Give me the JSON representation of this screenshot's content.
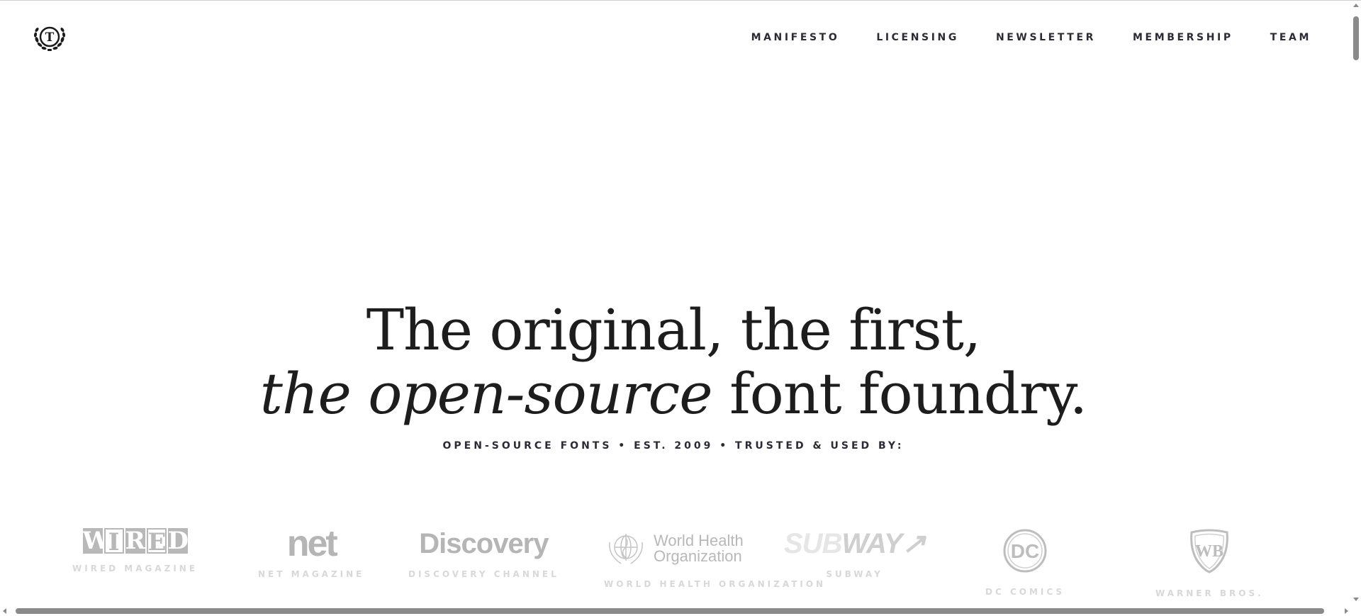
{
  "header": {
    "logo_icon": "laurel-t-monogram-icon",
    "logo_letter": "T",
    "nav": [
      {
        "label": "MANIFESTO"
      },
      {
        "label": "LICENSING"
      },
      {
        "label": "NEWSLETTER"
      },
      {
        "label": "MEMBERSHIP"
      },
      {
        "label": "TEAM"
      }
    ]
  },
  "hero": {
    "line1": "The original, the first,",
    "line2_italic": "the open-source",
    "line2_rest": " font foundry.",
    "tagline": "OPEN-SOURCE FONTS • EST. 2009 • TRUSTED & USED BY:"
  },
  "clients": [
    {
      "logo_text": "WIRED",
      "caption": "WIRED MAGAZINE"
    },
    {
      "logo_text": "net",
      "caption": "NET MAGAZINE"
    },
    {
      "logo_text": "Discovery",
      "caption": "DISCOVERY CHANNEL"
    },
    {
      "logo_line1": "World Health",
      "logo_line2": "Organization",
      "caption": "WORLD HEALTH ORGANIZATION"
    },
    {
      "logo_text_sub": "SUB",
      "logo_text_way": "WAY",
      "caption": "SUBWAY"
    },
    {
      "logo_text": "DC",
      "caption": "DC COMICS"
    },
    {
      "logo_text": "WB",
      "caption": "WARNER BROS."
    }
  ],
  "colors": {
    "text": "#1d1d1d",
    "nav_text": "#2b2b35",
    "logo_gray": "#b8b8b8",
    "caption_gray": "#d8d8d8",
    "scrollbar": "#8a8a8a"
  }
}
